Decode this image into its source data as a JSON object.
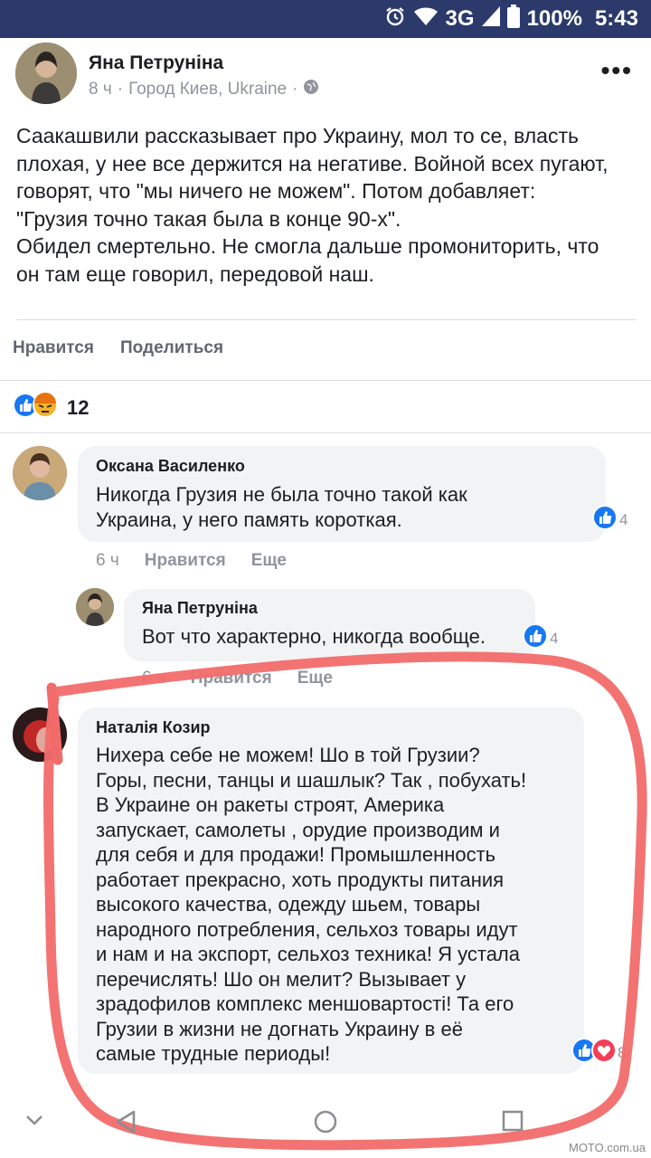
{
  "status": {
    "network": "3G",
    "battery": "100%",
    "time": "5:43"
  },
  "post": {
    "author": "Яна Петрунiна",
    "time": "8 ч",
    "location": "Город Киев, Ukraine",
    "lines": [
      "Саакашвили рассказывает про Украину, мол то се, власть",
      "плохая, у нее все держится на негативе. Войной всех пугают,",
      "говорят, что \"мы ничего не можем\". Потом добавляет:",
      "\"Грузия точно такая была в конце 90-х\".",
      "Обидел смертельно. Не смогла дальше промониторить, что",
      "он там еще говорил, передовой наш."
    ],
    "like_label": "Нравится",
    "share_label": "Поделиться",
    "reaction_count": "12"
  },
  "comments": [
    {
      "author": "Оксана Василенко",
      "lines": [
        "Никогда Грузия не была точно такой как",
        "Украина, у него память короткая."
      ],
      "reactions": "4",
      "time": "6 ч",
      "like": "Нравится",
      "more": "Еще"
    },
    {
      "author": "Яна Петрунiна",
      "lines": [
        "Вот что характерно, никогда вообще."
      ],
      "reactions": "4",
      "time": "6 ч",
      "like": "Нравится",
      "more": "Еще"
    },
    {
      "author": "Наталiя Козир",
      "lines": [
        "Нихера себе не можем! Шо в той Грузии?",
        "Горы, песни, танцы и шашлык? Так , побухать!",
        "В Украине он ракеты строят, Америка",
        "запускает, самолеты , орудие производим и",
        "для себя и для продажи! Промышленность",
        "работает прекрасно, хоть продукты питания",
        "высокого качества, одежду шьем, товары",
        "народного потребления, сельхоз товары идут",
        "и нам и на экспорт, сельхоз техника! Я устала",
        "перечислять! Шо он мелит? Вызывает у",
        "зрадофилов комплекс меншовартостi! Та его",
        "Грузии в жизни не догнать Украину в её",
        "самые трудные периоды!"
      ],
      "reactions": "8"
    }
  ],
  "watermark": "MOTO.com.ua",
  "colors": {
    "status_bar": "#2b3a6b",
    "like_blue": "#1877f2",
    "angry_orange": "#f7b125",
    "love_red": "#f33e58",
    "annotation": "#f26b6b"
  }
}
